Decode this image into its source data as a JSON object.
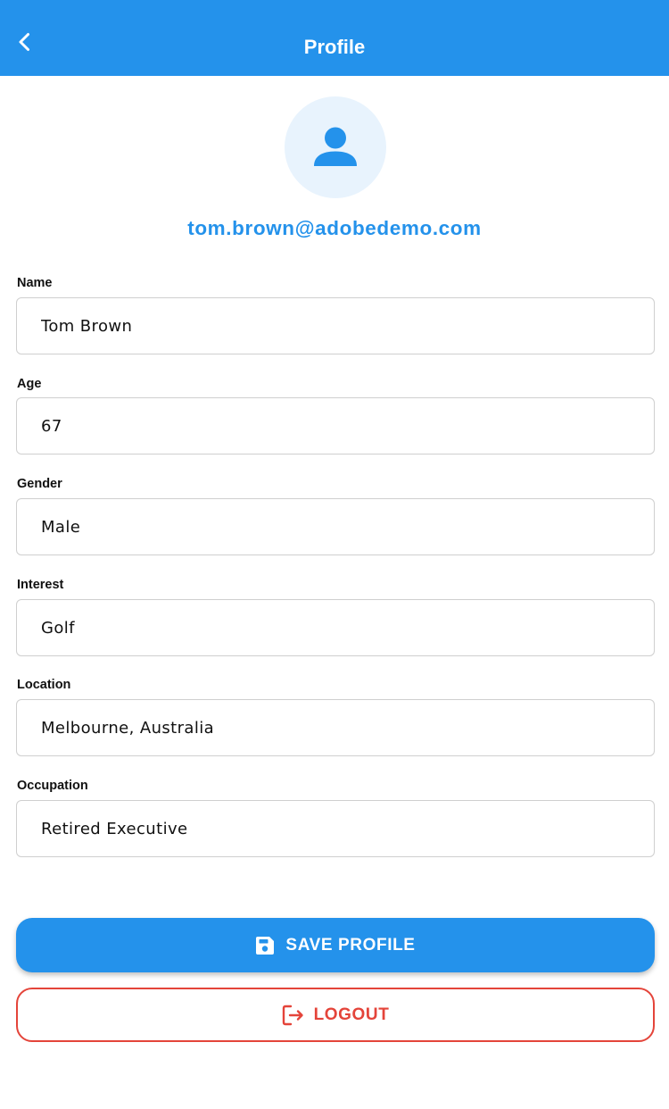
{
  "colors": {
    "primary": "#2492eb",
    "avatar_bg": "#e8f3fd",
    "danger": "#e4443a",
    "border": "#cfcfcf"
  },
  "header": {
    "title": "Profile",
    "back_icon": "chevron-left-icon"
  },
  "profile": {
    "avatar_icon": "person-icon",
    "email": "tom.brown@adobedemo.com"
  },
  "fields": {
    "name": {
      "label": "Name",
      "value": "Tom Brown"
    },
    "age": {
      "label": "Age",
      "value": "67"
    },
    "gender": {
      "label": "Gender",
      "value": "Male"
    },
    "interest": {
      "label": "Interest",
      "value": "Golf"
    },
    "location": {
      "label": "Location",
      "value": "Melbourne, Australia"
    },
    "occupation": {
      "label": "Occupation",
      "value": "Retired Executive"
    }
  },
  "actions": {
    "save_label": "SAVE PROFILE",
    "save_icon": "floppy-disk-icon",
    "logout_label": "LOGOUT",
    "logout_icon": "logout-icon"
  }
}
